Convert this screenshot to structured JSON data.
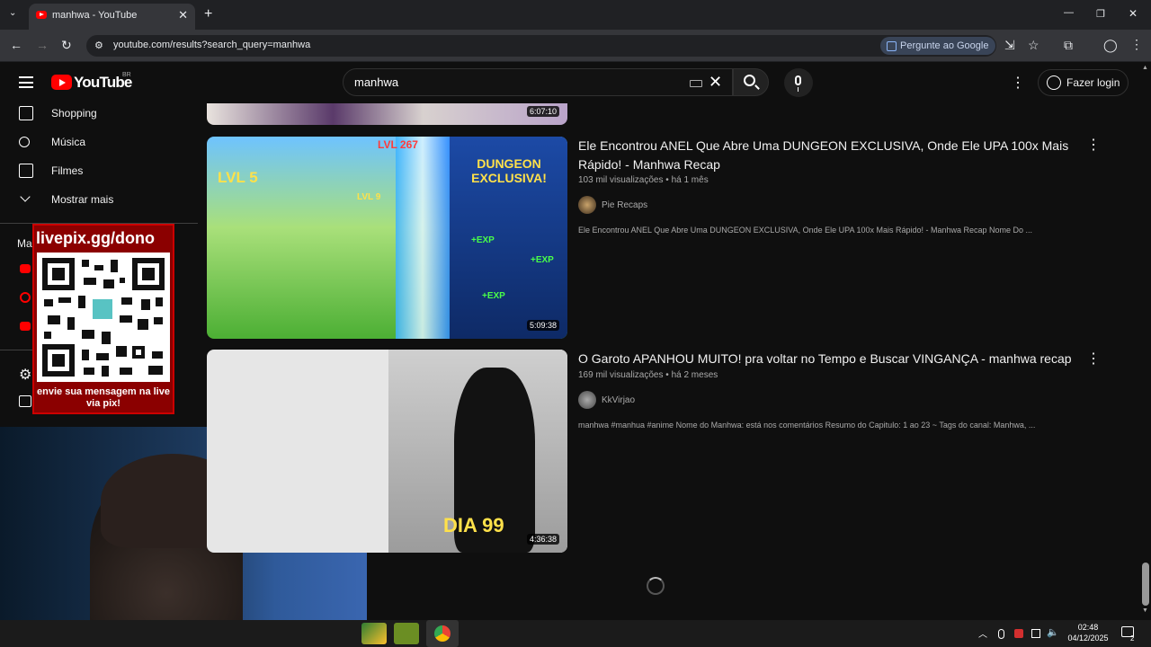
{
  "browser": {
    "tab_title": "manhwa - YouTube",
    "tab_close": "✕",
    "new_tab": "+",
    "url": "youtube.com/results?search_query=manhwa",
    "ask_google": "Pergunte ao Google",
    "window_controls": [
      "—",
      "❐",
      "✕"
    ]
  },
  "header": {
    "logo_text": "YouTube",
    "region": "BR",
    "search_value": "manhwa",
    "clear": "✕",
    "kebab": "⋮",
    "login": "Fazer login"
  },
  "sidebar": {
    "items": [
      {
        "label": "Shopping",
        "icon": "shopping-bag-icon"
      },
      {
        "label": "Música",
        "icon": "music-note-icon"
      },
      {
        "label": "Filmes",
        "icon": "film-icon"
      },
      {
        "label": "Mostrar mais",
        "icon": "chevron-down-icon"
      }
    ],
    "partial_label": "Ma"
  },
  "overlay": {
    "qr_url": "livepix.gg/dono",
    "qr_caption": "envie sua mensagem na live via pix!"
  },
  "videos": [
    {
      "duration": "6:07:10"
    },
    {
      "title": "Ele Encontrou ANEL Que Abre Uma DUNGEON EXCLUSIVA, Onde Ele UPA 100x Mais Rápido! - Manhwa Recap",
      "views": "103 mil visualizações",
      "age": "há 1 mês",
      "channel": "Pie Recaps",
      "description": "Ele Encontrou ANEL Que Abre Uma DUNGEON EXCLUSIVA, Onde Ele UPA 100x Mais Rápido! - Manhwa Recap Nome Do ...",
      "duration": "5:09:38",
      "thumb_text": {
        "lvl5": "LVL 5",
        "lvl267": "LVL 267",
        "lvl9": "LVL 9",
        "banner": "DUNGEON EXCLUSIVA!",
        "exp": "+EXP"
      }
    },
    {
      "title": "O Garoto APANHOU MUITO! pra voltar no Tempo e Buscar VINGANÇA - manhwa recap",
      "views": "169 mil visualizações",
      "age": "há 2 meses",
      "channel": "KkVirjao",
      "description": "manhwa #manhua #anime Nome do Manhwa: está nos comentários Resumo do Capitulo: 1 ao 23 ~ Tags do canal: Manhwa, ...",
      "duration": "4:36:38",
      "thumb_text": {
        "dia": "DIA 99"
      }
    }
  ],
  "taskbar": {
    "time": "02:48",
    "date": "04/12/2025",
    "notification_count": "2"
  },
  "colors": {
    "background": "#0f0f0f",
    "brand_red": "#ff0000",
    "ask_google_bg": "#394457"
  }
}
